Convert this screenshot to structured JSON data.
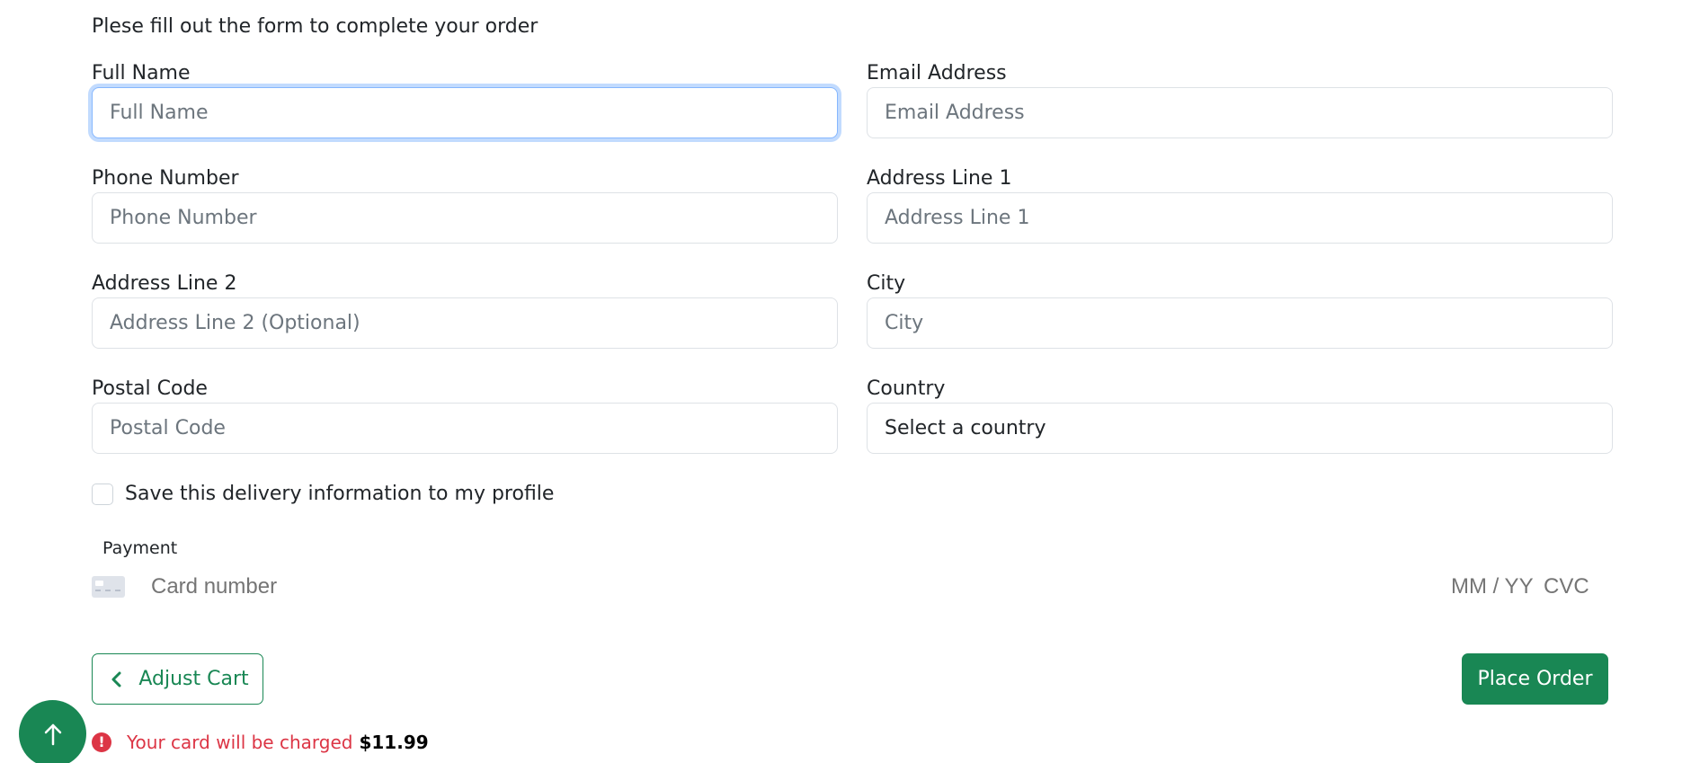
{
  "form": {
    "intro": "Plese fill out the form to complete your order",
    "fields": {
      "full_name": {
        "label": "Full Name",
        "placeholder": "Full Name",
        "value": ""
      },
      "email": {
        "label": "Email Address",
        "placeholder": "Email Address",
        "value": ""
      },
      "phone": {
        "label": "Phone Number",
        "placeholder": "Phone Number",
        "value": ""
      },
      "address1": {
        "label": "Address Line 1",
        "placeholder": "Address Line 1",
        "value": ""
      },
      "address2": {
        "label": "Address Line 2",
        "placeholder": "Address Line 2 (Optional)",
        "value": ""
      },
      "city": {
        "label": "City",
        "placeholder": "City",
        "value": ""
      },
      "postal": {
        "label": "Postal Code",
        "placeholder": "Postal Code",
        "value": ""
      },
      "country": {
        "label": "Country",
        "selected": "Select a country"
      }
    },
    "save_info": {
      "label": "Save this delivery information to my profile",
      "checked": false
    }
  },
  "payment": {
    "label": "Payment",
    "card_number_placeholder": "Card number",
    "expiry_placeholder": "MM / YY",
    "cvc_placeholder": "CVC",
    "card_icon": "credit-card-icon"
  },
  "actions": {
    "adjust_cart_label": "Adjust Cart",
    "adjust_cart_icon": "chevron-left-icon",
    "place_order_label": "Place Order"
  },
  "charge": {
    "icon": "exclamation-circle-icon",
    "text": "Your card will be charged",
    "amount": "$11.99"
  },
  "scroll_top": {
    "icon": "arrow-up-icon"
  },
  "colors": {
    "primary_green": "#198754",
    "danger_red": "#dc3545",
    "focus_blue": "#86b7fe",
    "border_gray": "#dee2e6",
    "placeholder_gray": "#6c757d"
  }
}
